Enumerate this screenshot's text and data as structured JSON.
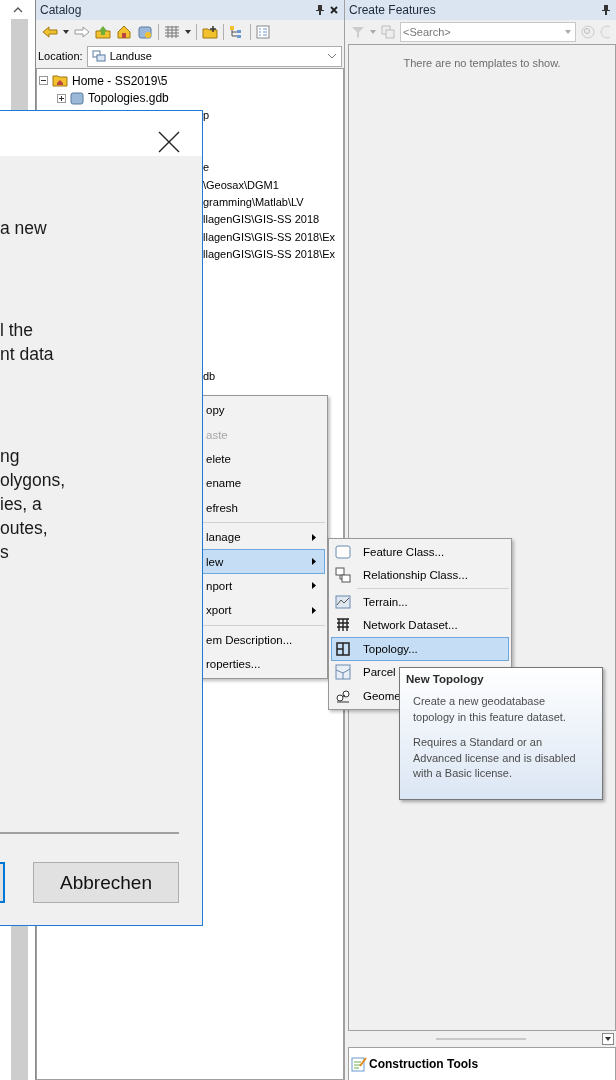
{
  "catalog": {
    "title": "Catalog",
    "location_label": "Location:",
    "location_value": "Landuse",
    "tree": [
      {
        "label": "Home - SS2019\\5",
        "expanded": true,
        "children": [
          {
            "label": "Topologies.gdb",
            "expanded": false
          }
        ]
      }
    ],
    "covered_rows": [
      {
        "text": "p"
      },
      {
        "text": "e"
      },
      {
        "text": "\\Geosax\\DGM1"
      },
      {
        "text": "gramming\\Matlab\\LV"
      },
      {
        "text": "llagenGIS\\GIS-SS 2018"
      },
      {
        "text": "llagenGIS\\GIS-SS 2018\\Ex"
      },
      {
        "text": "llagenGIS\\GIS-SS 2018\\Ex"
      },
      {
        "text": "db"
      }
    ]
  },
  "create_features": {
    "title": "Create Features",
    "search": {
      "placeholder": "<Search>"
    },
    "empty_message": "There are no templates to show.",
    "construction_tools": "Construction Tools"
  },
  "dialog": {
    "paragraphs": [
      [
        "a new"
      ],
      [
        "l the",
        "nt data"
      ],
      [
        "ng",
        "olygons,",
        "ies, a",
        "outes,",
        "s"
      ]
    ],
    "buttons": [
      {
        "default": true
      },
      {
        "default": false,
        "label": "Abbrechen"
      }
    ]
  },
  "context_menu": {
    "items": [
      {
        "kind": "item",
        "label": "opy",
        "disabled": false,
        "selected": false,
        "submenu": false
      },
      {
        "kind": "item",
        "label": "aste",
        "disabled": true,
        "selected": false,
        "submenu": false
      },
      {
        "kind": "item",
        "label": "elete",
        "disabled": false,
        "selected": false,
        "submenu": false
      },
      {
        "kind": "item",
        "label": "ename",
        "disabled": false,
        "selected": false,
        "submenu": false
      },
      {
        "kind": "item",
        "label": "efresh",
        "disabled": false,
        "selected": false,
        "submenu": false
      },
      {
        "kind": "separator"
      },
      {
        "kind": "item",
        "label": "lanage",
        "disabled": false,
        "selected": false,
        "submenu": true
      },
      {
        "kind": "item",
        "label": "lew",
        "disabled": false,
        "selected": true,
        "submenu": true
      },
      {
        "kind": "item",
        "label": "nport",
        "disabled": false,
        "selected": false,
        "submenu": true
      },
      {
        "kind": "item",
        "label": "xport",
        "disabled": false,
        "selected": false,
        "submenu": true
      },
      {
        "kind": "separator"
      },
      {
        "kind": "item",
        "label": "em Description...",
        "disabled": false,
        "selected": false,
        "submenu": false
      },
      {
        "kind": "item",
        "label": "roperties...",
        "disabled": false,
        "selected": false,
        "submenu": false
      }
    ]
  },
  "submenu": {
    "items": [
      {
        "kind": "feature-class",
        "label": "Feature Class...",
        "selected": false
      },
      {
        "kind": "relationship-class",
        "label": "Relationship Class...",
        "selected": false
      },
      {
        "kind": "separator"
      },
      {
        "kind": "terrain",
        "label": "Terrain...",
        "selected": false
      },
      {
        "kind": "network-dataset",
        "label": "Network Dataset...",
        "selected": false
      },
      {
        "kind": "topology",
        "label": "Topology...",
        "selected": true
      },
      {
        "kind": "parcel-fabric",
        "label": "Parcel",
        "selected": false
      },
      {
        "kind": "geometric-network",
        "label": "Geome",
        "selected": false
      }
    ]
  },
  "tooltip": {
    "title": "New Topology",
    "paragraphs": [
      "Create a new geodatabase topology in this feature dataset.",
      "Requires a Standard or an Advanced license and is disabled with a Basic license."
    ]
  }
}
